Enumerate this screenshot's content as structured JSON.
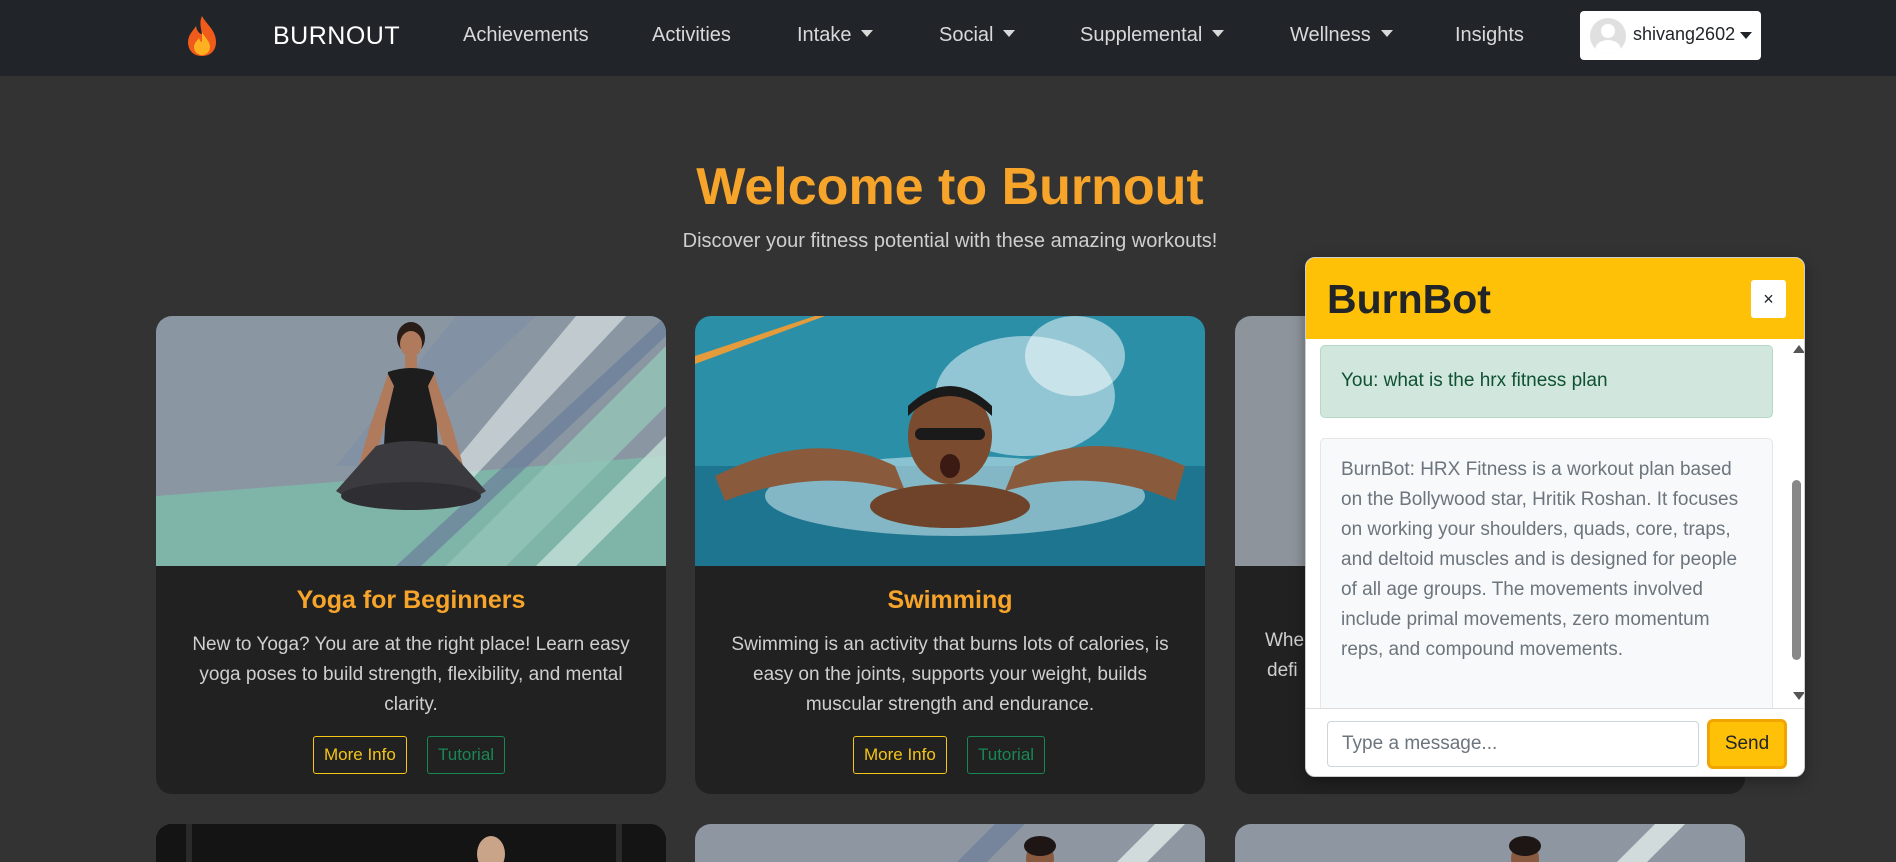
{
  "brand": {
    "name": "BURNOUT",
    "icon": "flame-icon"
  },
  "nav": {
    "achievements": "Achievements",
    "activities": "Activities",
    "intake": "Intake",
    "social": "Social",
    "supplemental": "Supplemental",
    "wellness": "Wellness",
    "insights": "Insights"
  },
  "user": {
    "name": "shivang2602"
  },
  "hero": {
    "title": "Welcome to Burnout",
    "subtitle": "Discover your fitness potential with these amazing workouts!"
  },
  "cards": [
    {
      "title": "Yoga for Beginners",
      "text": "New to Yoga? You are at the right place! Learn easy yoga poses to build strength, flexibility, and mental clarity.",
      "more": "More Info",
      "tutorial": "Tutorial"
    },
    {
      "title": "Swimming",
      "text": "Swimming is an activity that burns lots of calories, is easy on the joints, supports your weight, builds muscular strength and endurance.",
      "more": "More Info",
      "tutorial": "Tutorial"
    },
    {
      "text_fragment_1": "Whe",
      "text_fragment_2": "defi"
    }
  ],
  "chat": {
    "title": "BurnBot",
    "close": "×",
    "user_message": "You: what is the hrx fitness plan",
    "bot_message": "BurnBot: HRX Fitness is a workout plan based on the Bollywood star, Hritik Roshan. It focuses on working your shoulders, quads, core, traps, and deltoid muscles and is designed for people of all age groups. The movements involved include primal movements, zero momentum reps, and compound movements.",
    "input_placeholder": "Type a message...",
    "send": "Send"
  },
  "colors": {
    "navbar_bg": "#212529",
    "page_bg": "#333333",
    "accent_orange": "#f7a42a",
    "chat_header": "#ffc107",
    "more_info_border": "#f5c518",
    "tutorial_border": "#198754"
  }
}
